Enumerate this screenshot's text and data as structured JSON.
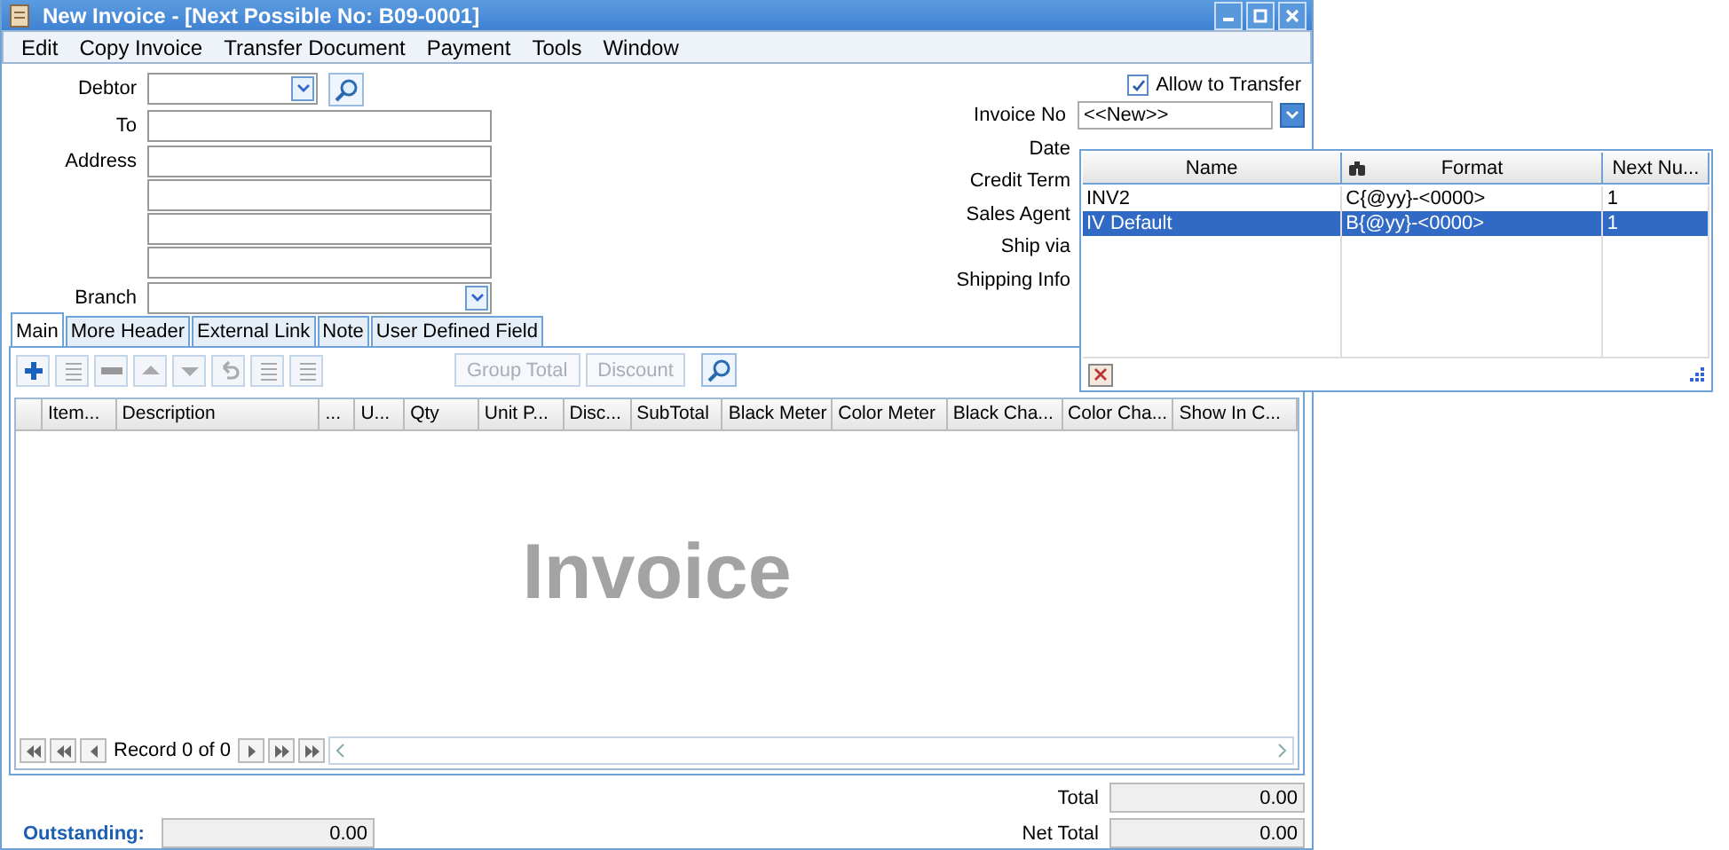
{
  "window": {
    "title": "New Invoice - [Next Possible No: B09-0001]"
  },
  "menu": [
    "Edit",
    "Copy Invoice",
    "Transfer Document",
    "Payment",
    "Tools",
    "Window"
  ],
  "left_fields": [
    {
      "label": "Debtor",
      "kind": "combo"
    },
    {
      "label": "To",
      "kind": "text"
    },
    {
      "label": "Address",
      "kind": "multiline"
    },
    {
      "label": "Branch",
      "kind": "select"
    }
  ],
  "allow_transfer": {
    "label": "Allow to Transfer",
    "checked": true
  },
  "right_labels": [
    "Invoice No",
    "Date",
    "Credit Term",
    "Sales Agent",
    "Ship via",
    "Shipping Info"
  ],
  "invoice_no": {
    "value": "<<New>>"
  },
  "tabs": [
    {
      "label": "Main",
      "selected": true
    },
    {
      "label": "More Header",
      "selected": false
    },
    {
      "label": "External Link",
      "selected": false
    },
    {
      "label": "Note",
      "selected": false
    },
    {
      "label": "User Defined Field",
      "selected": false
    }
  ],
  "toolbar_buttons": [
    {
      "label": "Group Total",
      "disabled": true
    },
    {
      "label": "Discount",
      "disabled": true
    }
  ],
  "grid": {
    "columns": [
      "Item...",
      "Description",
      "...",
      "U...",
      "Qty",
      "Unit P...",
      "Disc...",
      "SubTotal",
      "Black Meter",
      "Color Meter",
      "Black Cha...",
      "Color Cha...",
      "Show In C..."
    ],
    "empty_text": "Invoice"
  },
  "navigator": {
    "record": "Record 0 of 0"
  },
  "totals": {
    "total_label": "Total",
    "total": "0.00",
    "outstanding_label": "Outstanding:",
    "outstanding": "0.00",
    "net_total_label": "Net Total",
    "net_total": "0.00"
  },
  "popup": {
    "columns": [
      "Name",
      "Format",
      "Next Nu..."
    ],
    "rows": [
      {
        "cells": [
          "INV2",
          "C{@yy}-<0000>",
          "1"
        ],
        "selected": false
      },
      {
        "cells": [
          "IV Default",
          "B{@yy}-<0000>",
          "1"
        ],
        "selected": true
      }
    ]
  }
}
